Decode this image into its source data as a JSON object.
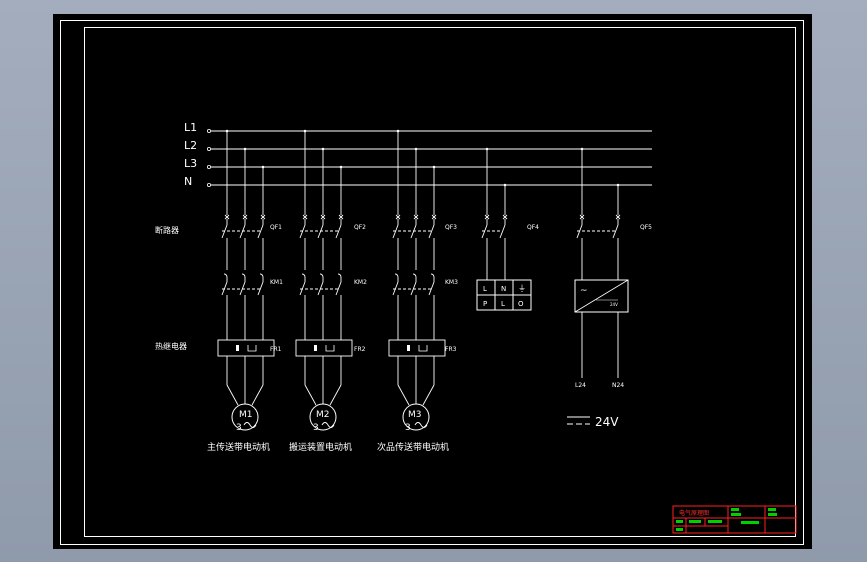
{
  "buses": [
    "L1",
    "L2",
    "L3",
    "N"
  ],
  "row_labels": {
    "breaker": "断路器",
    "thermal": "热继电器"
  },
  "motors": [
    {
      "qf": "QF1",
      "km": "KM1",
      "fr": "FR1",
      "tag": "M1",
      "phase": "3",
      "name": "主传送带电动机"
    },
    {
      "qf": "QF2",
      "km": "KM2",
      "fr": "FR2",
      "tag": "M2",
      "phase": "3",
      "name": "搬运装置电动机"
    },
    {
      "qf": "QF3",
      "km": "KM3",
      "fr": "FR3",
      "tag": "M3",
      "phase": "3",
      "name": "次品传送带电动机"
    }
  ],
  "qf4": {
    "label": "QF4",
    "top": [
      "L",
      "N",
      "⏚"
    ],
    "bottom": [
      "P",
      "L",
      "O"
    ]
  },
  "qf5": {
    "label": "QF5",
    "psu_in": "~",
    "psu_out": "24V",
    "outputs": [
      "L24",
      "N24"
    ]
  },
  "dc_label": "24V",
  "title_block": {
    "title": "电气原理图"
  },
  "colors": {
    "line": "#ffffff",
    "bg": "#000000",
    "title_block": "#ff2020",
    "title_text": "#00ff00"
  }
}
